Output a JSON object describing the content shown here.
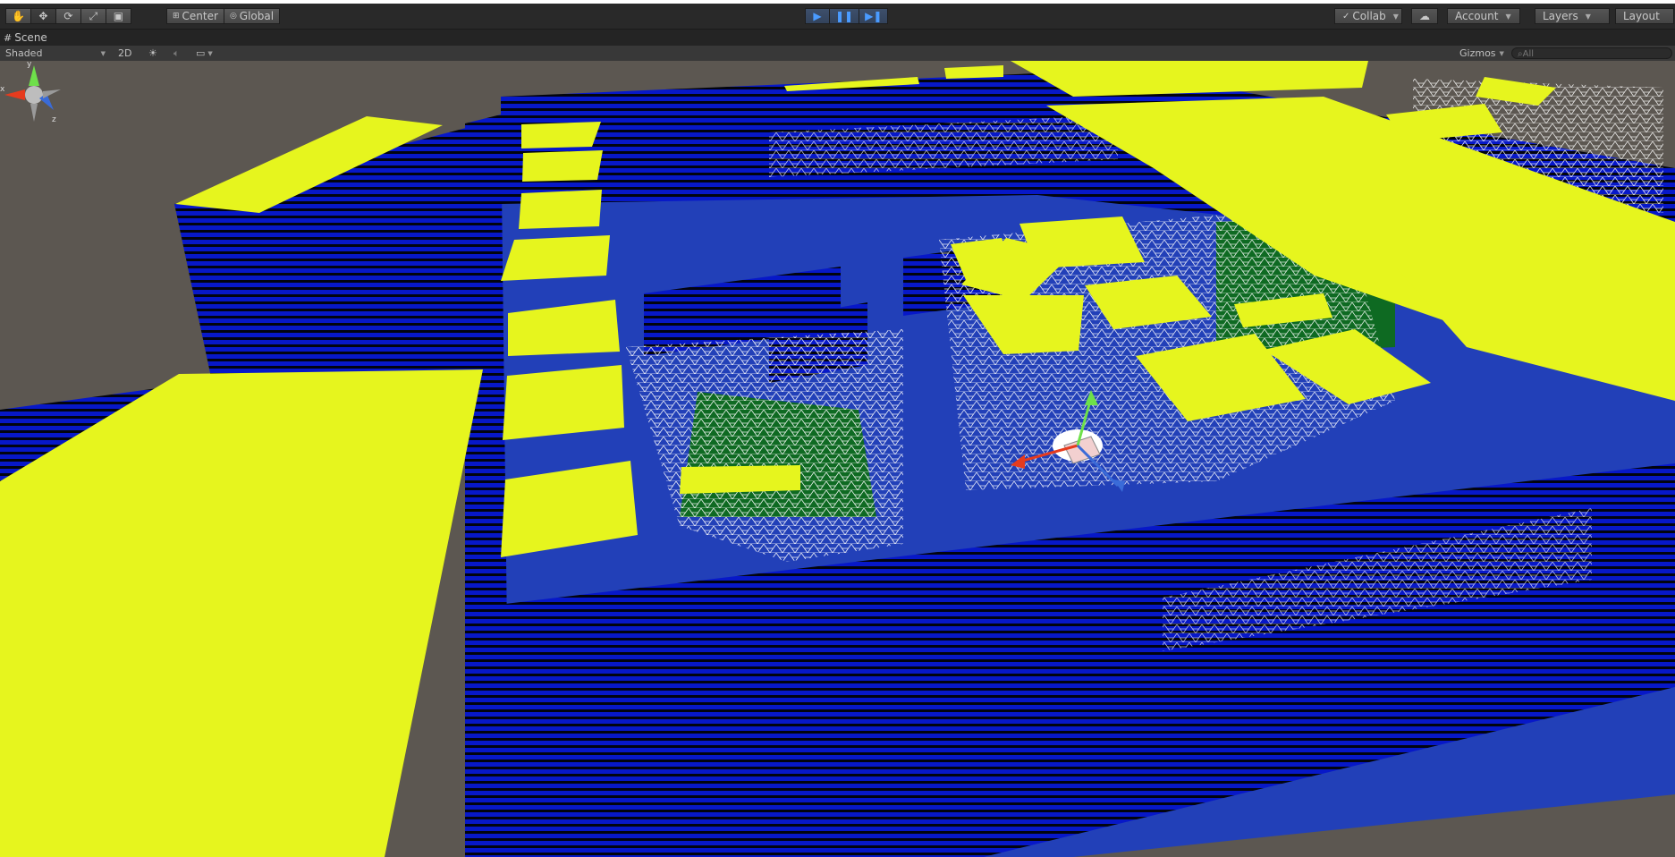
{
  "toolbar": {
    "pivot_label": "Center",
    "space_label": "Global",
    "collab_label": "Collab",
    "account_label": "Account",
    "layers_label": "Layers",
    "layout_label": "Layout"
  },
  "scene_tab": {
    "label": "Scene"
  },
  "scene_options": {
    "shading_mode": "Shaded",
    "mode_2d": "2D",
    "gizmos_label": "Gizmos",
    "search_placeholder": "All"
  },
  "colors": {
    "floor": "#2240b8",
    "wall": "#0a1ad0",
    "yellow_panel": "#e6f51e",
    "green_area": "#0e6a22",
    "background": "#5c5751"
  },
  "icons": [
    "hand-icon",
    "move-icon",
    "rotate-icon",
    "scale-icon",
    "rect-icon",
    "play-icon",
    "pause-icon",
    "step-icon",
    "cloud-icon",
    "light-icon",
    "audio-icon",
    "effects-icon"
  ]
}
